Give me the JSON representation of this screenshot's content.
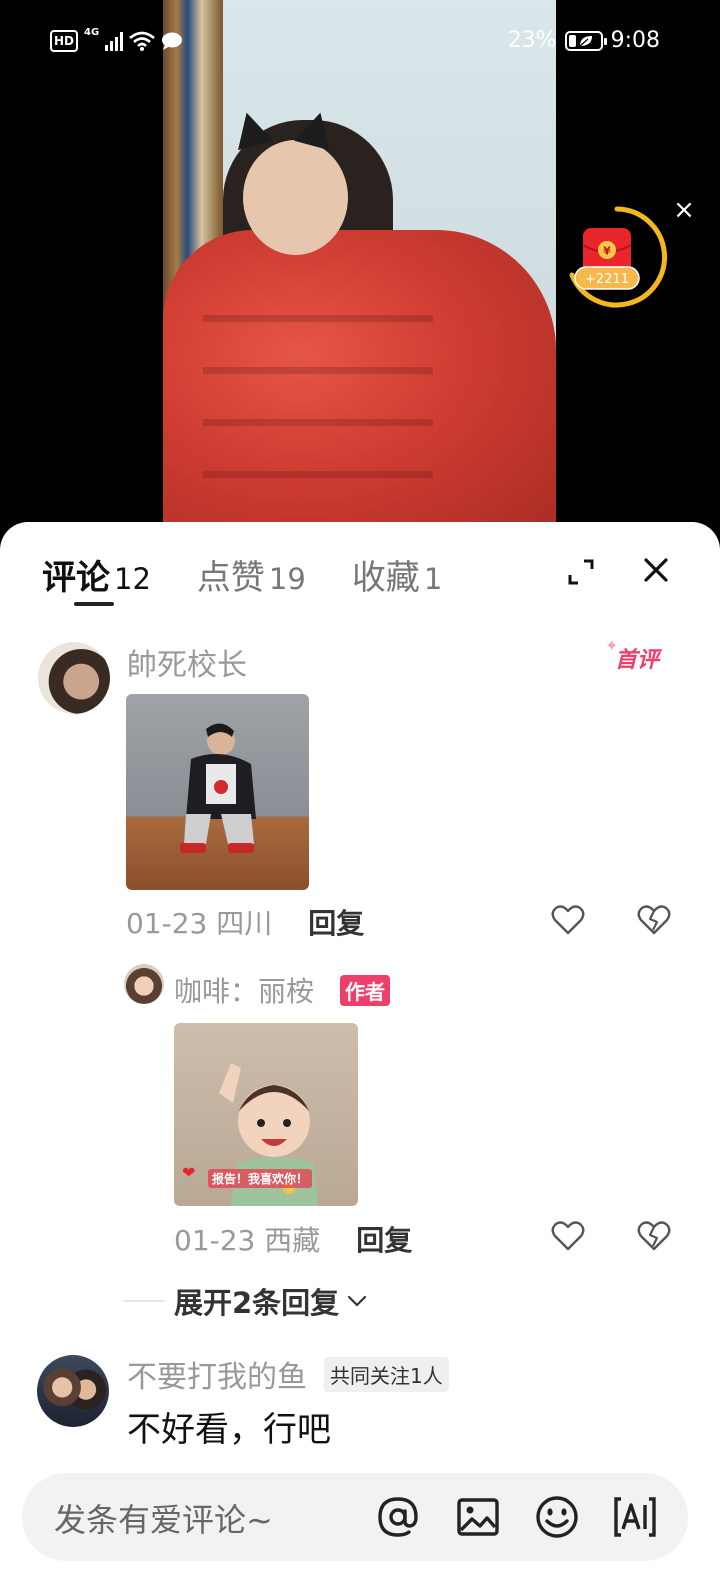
{
  "status_bar": {
    "hd": "HD",
    "network": "4G",
    "battery_pct": "23%",
    "time": "9:08"
  },
  "red_packet": {
    "symbol": "¥",
    "amount": "+2211",
    "close_glyph": "×"
  },
  "tabs": [
    {
      "label": "评论",
      "count": "12",
      "active": true
    },
    {
      "label": "点赞",
      "count": "19",
      "active": false
    },
    {
      "label": "收藏",
      "count": "1",
      "active": false
    }
  ],
  "comments": [
    {
      "username": "帥死校长",
      "badge": "首评",
      "date_location": "01-23 四川",
      "reply_label": "回复",
      "replies": [
        {
          "username": "咖啡：丽桉",
          "author_tag": "作者",
          "sticker_text": "报告！我喜欢你！",
          "date_location": "01-23 西藏",
          "reply_label": "回复"
        }
      ],
      "expand_label": "展开2条回复"
    },
    {
      "username": "不要打我的鱼",
      "mutual_tag": "共同关注1人",
      "text": "不好看，行吧"
    }
  ],
  "input_bar": {
    "placeholder": "发条有爱评论~"
  },
  "colors": {
    "accent_pink": "#ee3f6a",
    "packet_red": "#e8262c",
    "packet_gold": "#f5b81c"
  }
}
